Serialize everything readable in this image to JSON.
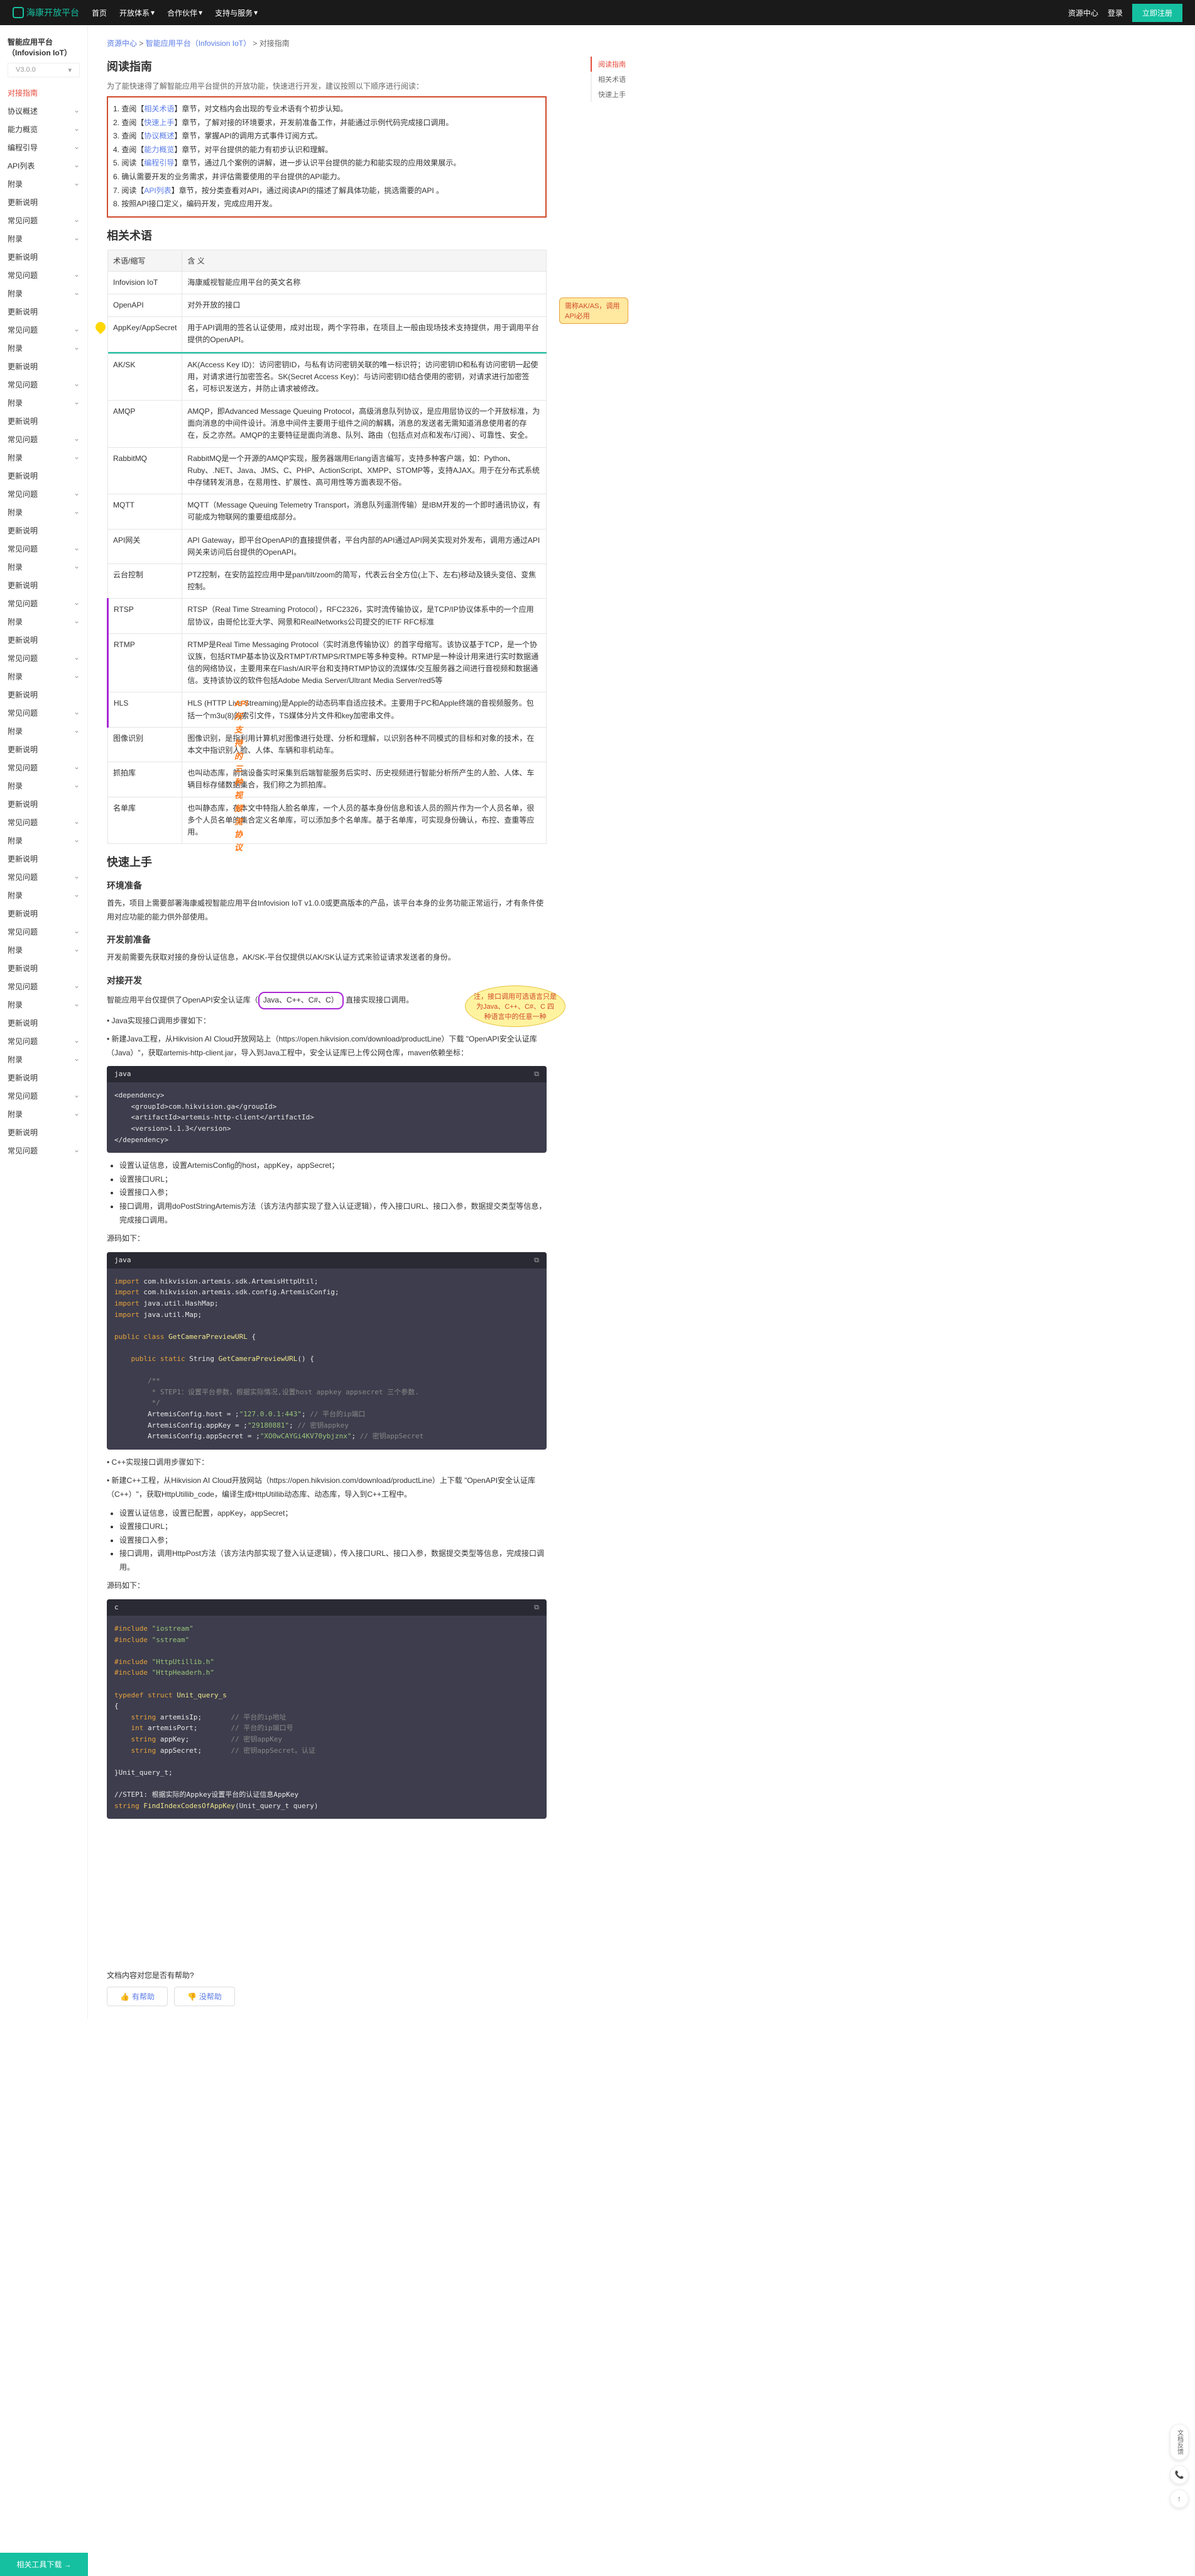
{
  "header": {
    "logo": "海康开放平台",
    "nav": [
      "首页",
      "开放体系",
      "合作伙伴",
      "支持与服务"
    ],
    "right": [
      "资源中心",
      "登录",
      "立即注册"
    ]
  },
  "sidebar": {
    "title": "智能应用平台（Infovision IoT）",
    "version": "V3.0.0",
    "items": [
      {
        "label": "对接指南",
        "active": true,
        "hasChildren": false
      },
      {
        "label": "协议概述",
        "hasChildren": true
      },
      {
        "label": "能力概览",
        "hasChildren": true
      },
      {
        "label": "编程引导",
        "hasChildren": true
      },
      {
        "label": "API列表",
        "hasChildren": true
      },
      {
        "label": "附录",
        "hasChildren": true
      },
      {
        "label": "更新说明",
        "hasChildren": false
      },
      {
        "label": "常见问题",
        "hasChildren": true
      },
      {
        "label": "附录",
        "hasChildren": true
      },
      {
        "label": "更新说明",
        "hasChildren": false
      },
      {
        "label": "常见问题",
        "hasChildren": true
      },
      {
        "label": "附录",
        "hasChildren": true
      },
      {
        "label": "更新说明",
        "hasChildren": false
      },
      {
        "label": "常见问题",
        "hasChildren": true
      },
      {
        "label": "附录",
        "hasChildren": true
      },
      {
        "label": "更新说明",
        "hasChildren": false
      },
      {
        "label": "常见问题",
        "hasChildren": true
      },
      {
        "label": "附录",
        "hasChildren": true
      },
      {
        "label": "更新说明",
        "hasChildren": false
      },
      {
        "label": "常见问题",
        "hasChildren": true
      },
      {
        "label": "附录",
        "hasChildren": true
      },
      {
        "label": "更新说明",
        "hasChildren": false
      },
      {
        "label": "常见问题",
        "hasChildren": true
      },
      {
        "label": "附录",
        "hasChildren": true
      },
      {
        "label": "更新说明",
        "hasChildren": false
      },
      {
        "label": "常见问题",
        "hasChildren": true
      },
      {
        "label": "附录",
        "hasChildren": true
      },
      {
        "label": "更新说明",
        "hasChildren": false
      },
      {
        "label": "常见问题",
        "hasChildren": true
      },
      {
        "label": "附录",
        "hasChildren": true
      },
      {
        "label": "更新说明",
        "hasChildren": false
      },
      {
        "label": "常见问题",
        "hasChildren": true
      },
      {
        "label": "附录",
        "hasChildren": true
      },
      {
        "label": "更新说明",
        "hasChildren": false
      },
      {
        "label": "常见问题",
        "hasChildren": true
      },
      {
        "label": "附录",
        "hasChildren": true
      },
      {
        "label": "更新说明",
        "hasChildren": false
      },
      {
        "label": "常见问题",
        "hasChildren": true
      },
      {
        "label": "附录",
        "hasChildren": true
      },
      {
        "label": "更新说明",
        "hasChildren": false
      },
      {
        "label": "常见问题",
        "hasChildren": true
      },
      {
        "label": "附录",
        "hasChildren": true
      },
      {
        "label": "更新说明",
        "hasChildren": false
      },
      {
        "label": "常见问题",
        "hasChildren": true
      },
      {
        "label": "附录",
        "hasChildren": true
      },
      {
        "label": "更新说明",
        "hasChildren": false
      },
      {
        "label": "常见问题",
        "hasChildren": true
      },
      {
        "label": "附录",
        "hasChildren": true
      },
      {
        "label": "更新说明",
        "hasChildren": false
      },
      {
        "label": "常见问题",
        "hasChildren": true
      },
      {
        "label": "附录",
        "hasChildren": true
      },
      {
        "label": "更新说明",
        "hasChildren": false
      },
      {
        "label": "常见问题",
        "hasChildren": true
      },
      {
        "label": "附录",
        "hasChildren": true
      },
      {
        "label": "更新说明",
        "hasChildren": false
      },
      {
        "label": "常见问题",
        "hasChildren": true
      },
      {
        "label": "附录",
        "hasChildren": true
      },
      {
        "label": "更新说明",
        "hasChildren": false
      },
      {
        "label": "常见问题",
        "hasChildren": true
      }
    ]
  },
  "breadcrumb": {
    "a": "资源中心",
    "b": "智能应用平台（Infovision IoT）",
    "c": "对接指南"
  },
  "rightNav": [
    "阅读指南",
    "相关术语",
    "快速上手"
  ],
  "h1": "阅读指南",
  "intro": "为了能快速得了解智能应用平台提供的开放功能，快速进行开发，建议按照以下顺序进行阅读：",
  "guide": [
    {
      "n": "1. 查阅【",
      "link": "相关术语",
      "t": "】章节，对文档内会出现的专业术语有个初步认知。"
    },
    {
      "n": "2. 查阅【",
      "link": "快速上手",
      "t": "】章节，了解对接的环境要求，开发前准备工作，并能通过示例代码完成接口调用。"
    },
    {
      "n": "3. 查阅【",
      "link": "协议概述",
      "t": "】章节，掌握API的调用方式事件订阅方式。"
    },
    {
      "n": "4. 查阅【",
      "link": "能力概览",
      "t": "】章节，对平台提供的能力有初步认识和理解。"
    },
    {
      "n": "5. 阅读【",
      "link": "编程引导",
      "t": "】章节，通过几个案例的讲解，进一步认识平台提供的能力和能实现的应用效果展示。"
    },
    {
      "n": "6. 确认需要开发的业务需求，并评估需要使用的平台提供的API能力。",
      "link": "",
      "t": ""
    },
    {
      "n": "7. 阅读【",
      "link": "API列表",
      "t": "】章节，按分类查看对API，通过阅读API的描述了解具体功能，挑选需要的API 。"
    },
    {
      "n": "8. 按照API接口定义，编码开发，完成应用开发。",
      "link": "",
      "t": ""
    }
  ],
  "h2_terms": "相关术语",
  "terms_th": [
    "术语/缩写",
    "含 义"
  ],
  "terms": [
    {
      "k": "Infovision IoT",
      "v": "海康威视智能应用平台的英文名称"
    },
    {
      "k": "OpenAPI",
      "v": "对外开放的接口"
    },
    {
      "k": "AppKey/AppSecret",
      "v": "用于API调用的签名认证使用，成对出现，两个字符串，在项目上一般由现场技术支持提供，用于调用平台提供的OpenAPI。"
    },
    {
      "k": "AK/SK",
      "v": "AK(Access Key ID)：访问密钥ID，与私有访问密钥关联的唯一标识符；访问密钥ID和私有访问密钥一起使用，对请求进行加密签名。SK(Secret Access Key)：与访问密钥ID结合使用的密钥，对请求进行加密签名，可标识发送方，并防止请求被修改。"
    },
    {
      "k": "AMQP",
      "v": "AMQP，即Advanced Message Queuing Protocol，高级消息队列协议，是应用层协议的一个开放标准，为面向消息的中间件设计。消息中间件主要用于组件之间的解耦，消息的发送者无需知道消息使用者的存在，反之亦然。AMQP的主要特征是面向消息、队列、路由（包括点对点和发布/订阅）、可靠性、安全。"
    },
    {
      "k": "RabbitMQ",
      "v": "RabbitMQ是一个开源的AMQP实现，服务器端用Erlang语言编写，支持多种客户端，如：Python、Ruby、.NET、Java、JMS、C、PHP、ActionScript、XMPP、STOMP等，支持AJAX。用于在分布式系统中存储转发消息，在易用性、扩展性、高可用性等方面表现不俗。"
    },
    {
      "k": "MQTT",
      "v": "MQTT（Message Queuing Telemetry Transport，消息队列遥测传输）是IBM开发的一个即时通讯协议，有可能成为物联网的重要组成部分。"
    },
    {
      "k": "API网关",
      "v": "API Gateway，即平台OpenAPI的直接提供者，平台内部的API通过API网关实现对外发布，调用方通过API网关来访问后台提供的OpenAPI。"
    },
    {
      "k": "云台控制",
      "v": "PTZ控制，在安防监控应用中是pan/tilt/zoom的简写，代表云台全方位(上下、左右)移动及镜头变倍、变焦控制。"
    },
    {
      "k": "RTSP",
      "v": "RTSP（Real Time Streaming Protocol），RFC2326，实时流传输协议，是TCP/IP协议体系中的一个应用层协议，由哥伦比亚大学、网景和RealNetworks公司提交的IETF RFC标准"
    },
    {
      "k": "RTMP",
      "v": "RTMP是Real Time Messaging Protocol（实时消息传输协议）的首字母缩写。该协议基于TCP，是一个协议族，包括RTMP基本协议及RTMPT/RTMPS/RTMPE等多种变种。RTMP是一种设计用来进行实时数据通信的网络协议，主要用来在Flash/AIR平台和支持RTMP协议的流媒体/交互服务器之间进行音视频和数据通信。支持该协议的软件包括Adobe Media Server/Ultrant Media Server/red5等"
    },
    {
      "k": "HLS",
      "v": "HLS (HTTP Live Streaming)是Apple的动态码率自适应技术。主要用于PC和Apple终端的音视频服务。包括一个m3u(8)的索引文件，TS媒体分片文件和key加密串文件。"
    },
    {
      "k": "图像识别",
      "v": "图像识别，是指利用计算机对图像进行处理、分析和理解，以识别各种不同模式的目标和对象的技术，在本文中指识别人脸、人体、车辆和非机动车。"
    },
    {
      "k": "抓拍库",
      "v": "也叫动态库，前端设备实时采集到后端智能服务后实时、历史视频进行智能分析所产生的人脸、人体、车辆目标存储数据集合，我们称之为抓拍库。"
    },
    {
      "k": "名单库",
      "v": "也叫静态库，在本文中特指人脸名单库，一个人员的基本身份信息和该人员的照片作为一个人员名单，很多个人员名单的集合定义名单库，可以添加多个名单库。基于名单库，可实现身份确认，布控、查重等应用。"
    }
  ],
  "annotations": {
    "akas": "需称AK/AS，调用API必用",
    "video_protocols": "API所支持的三种视频流协议",
    "lang_note": "注，接口调用可选语言只是为Java、C++、C#、C 四种语言中的任意一种",
    "lang_box": "Java、C++、C#、C）"
  },
  "h2_quick": "快速上手",
  "quick": {
    "env_h": "环境准备",
    "env_t": "首先，项目上需要部署海康威视智能应用平台Infovision IoT v1.0.0或更高版本的产品，该平台本身的业务功能正常运行，才有条件使用对应功能的能力供外部使用。",
    "prep_h": "开发前准备",
    "prep_t": "开发前需要先获取对接的身份认证信息，AK/SK-平台仅提供以AK/SK认证方式来验证请求发送者的身份。",
    "dev_h": "对接开发",
    "dev_t_pre": "智能应用平台仅提供了OpenAPI安全认证库（",
    "dev_t_post": " 直接实现接口调用。",
    "java_h": "• Java实现接口调用步骤如下：",
    "java_step": "• 新建Java工程，从Hikvision AI Cloud开放网站上（https://open.hikvision.com/download/productLine）下载 \"OpenAPI安全认证库（Java）\"，获取artemis-http-client.jar，导入到Java工程中，安全认证库已上传公网仓库，maven依赖坐标：",
    "code1_lang": "java",
    "code1": "<dependency>\n    <groupId>com.hikvision.ga</groupId>\n    <artifactId>artemis-http-client</artifactId>\n    <version>1.1.3</version>\n</dependency>",
    "bullets1": [
      "设置认证信息，设置ArtemisConfig的host，appKey，appSecret；",
      "设置接口URL；",
      "设置接口入参；",
      "接口调用，调用doPostStringArtemis方法（该方法内部实现了登入认证逻辑），传入接口URL、接口入参，数据提交类型等信息，完成接口调用。"
    ],
    "src_label": "源码如下：",
    "code2_lang": "java",
    "cpp_h": "• C++实现接口调用步骤如下：",
    "cpp_step": "• 新建C++工程，从Hikvision AI Cloud开放网站（https://open.hikvision.com/download/productLine）上下载 \"OpenAPI安全认证库（C++）\"，获取HttpUtillib_code，编译生成HttpUtillib动态库、动态库，导入到C++工程中。",
    "bullets2": [
      "设置认证信息，设置已配置，appKey，appSecret；",
      "设置接口URL；",
      "设置接口入参；",
      "接口调用，调用HttpPost方法（该方法内部实现了登入认证逻辑），传入接口URL、接口入参，数据提交类型等信息，完成接口调用。"
    ],
    "code3_lang": "c"
  },
  "code2_lines": [
    {
      "t": "import",
      "c": "kw-orange",
      "r": " com.hikvision.artemis.sdk.ArtemisHttpUtil;"
    },
    {
      "t": "import",
      "c": "kw-orange",
      "r": " com.hikvision.artemis.sdk.config.ArtemisConfig;"
    },
    {
      "t": "import",
      "c": "kw-orange",
      "r": " java.util.HashMap;"
    },
    {
      "t": "import",
      "c": "kw-orange",
      "r": " java.util.Map;"
    },
    {
      "t": "",
      "c": "",
      "r": ""
    },
    {
      "t": "public class ",
      "c": "kw-orange",
      "r": "",
      "y": "GetCameraPreviewURL",
      "p": " {"
    },
    {
      "t": "",
      "c": "",
      "r": ""
    },
    {
      "t": "    public static ",
      "c": "kw-orange",
      "r": "String ",
      "y": "GetCameraPreviewURL",
      "p": "() {"
    },
    {
      "t": "",
      "c": "",
      "r": ""
    },
    {
      "t": "        /**",
      "c": "kw-grey",
      "r": ""
    },
    {
      "t": "         * STEP1：设置平台参数，根据实际情况,设置host appkey appsecret 三个参数.",
      "c": "kw-grey",
      "r": ""
    },
    {
      "t": "         */",
      "c": "kw-grey",
      "r": ""
    },
    {
      "t": "        ArtemisConfig.host = ",
      "c": "",
      "g": "\"127.0.0.1:443\"",
      "r": ";",
      "cm": "// 平台的ip端口"
    },
    {
      "t": "        ArtemisConfig.appKey = ",
      "c": "",
      "g": "\"29180881\"",
      "r": ";",
      "cm": "// 密钥appkey"
    },
    {
      "t": "        ArtemisConfig.appSecret = ",
      "c": "",
      "g": "\"XO0wCAYGi4KV70ybjznx\"",
      "r": ";",
      "cm": "// 密钥appSecret"
    }
  ],
  "code3_lines": [
    {
      "t": "#include ",
      "c": "kw-orange",
      "g": "\"iostream\""
    },
    {
      "t": "#include ",
      "c": "kw-orange",
      "g": "\"sstream\""
    },
    {
      "t": "",
      "c": "",
      "r": ""
    },
    {
      "t": "#include ",
      "c": "kw-orange",
      "g": "\"HttpUtillib.h\""
    },
    {
      "t": "#include ",
      "c": "kw-orange",
      "g": "\"HttpHeaderh.h\""
    },
    {
      "t": "",
      "c": "",
      "r": ""
    },
    {
      "t": "typedef struct ",
      "c": "kw-orange",
      "y": "Unit_query_s"
    },
    {
      "t": "{",
      "c": "",
      "r": ""
    },
    {
      "t": "    string",
      "c": "kw-orange",
      "r": " artemisIp;",
      "cm": "      // 平台的ip地址"
    },
    {
      "t": "    int",
      "c": "kw-orange",
      "r": " artemisPort;",
      "cm": "       // 平台的ip端口号"
    },
    {
      "t": "    string",
      "c": "kw-orange",
      "r": " appKey;",
      "cm": "         // 密钥appKey"
    },
    {
      "t": "    string",
      "c": "kw-orange",
      "r": " appSecret;",
      "cm": "      // 密钥appSecret。认证"
    },
    {
      "t": "",
      "c": "",
      "r": ""
    },
    {
      "t": "}Unit_query_t;",
      "c": "",
      "r": ""
    },
    {
      "t": "",
      "c": "",
      "r": ""
    },
    {
      "t": "",
      "c": "kw-grey",
      "r": "//STEP1: 根据实际的Appkey设置平台的认证信息AppKey"
    },
    {
      "t": "string ",
      "c": "kw-orange",
      "y": "FindIndexCodesOfAppKey",
      "r": "(Unit_query_t query)"
    }
  ],
  "feedback": {
    "q": "文档内容对您是否有帮助?",
    "yes": "有帮助",
    "no": "没帮助"
  },
  "download": "相关工具下载 →",
  "float": "文档反馈"
}
